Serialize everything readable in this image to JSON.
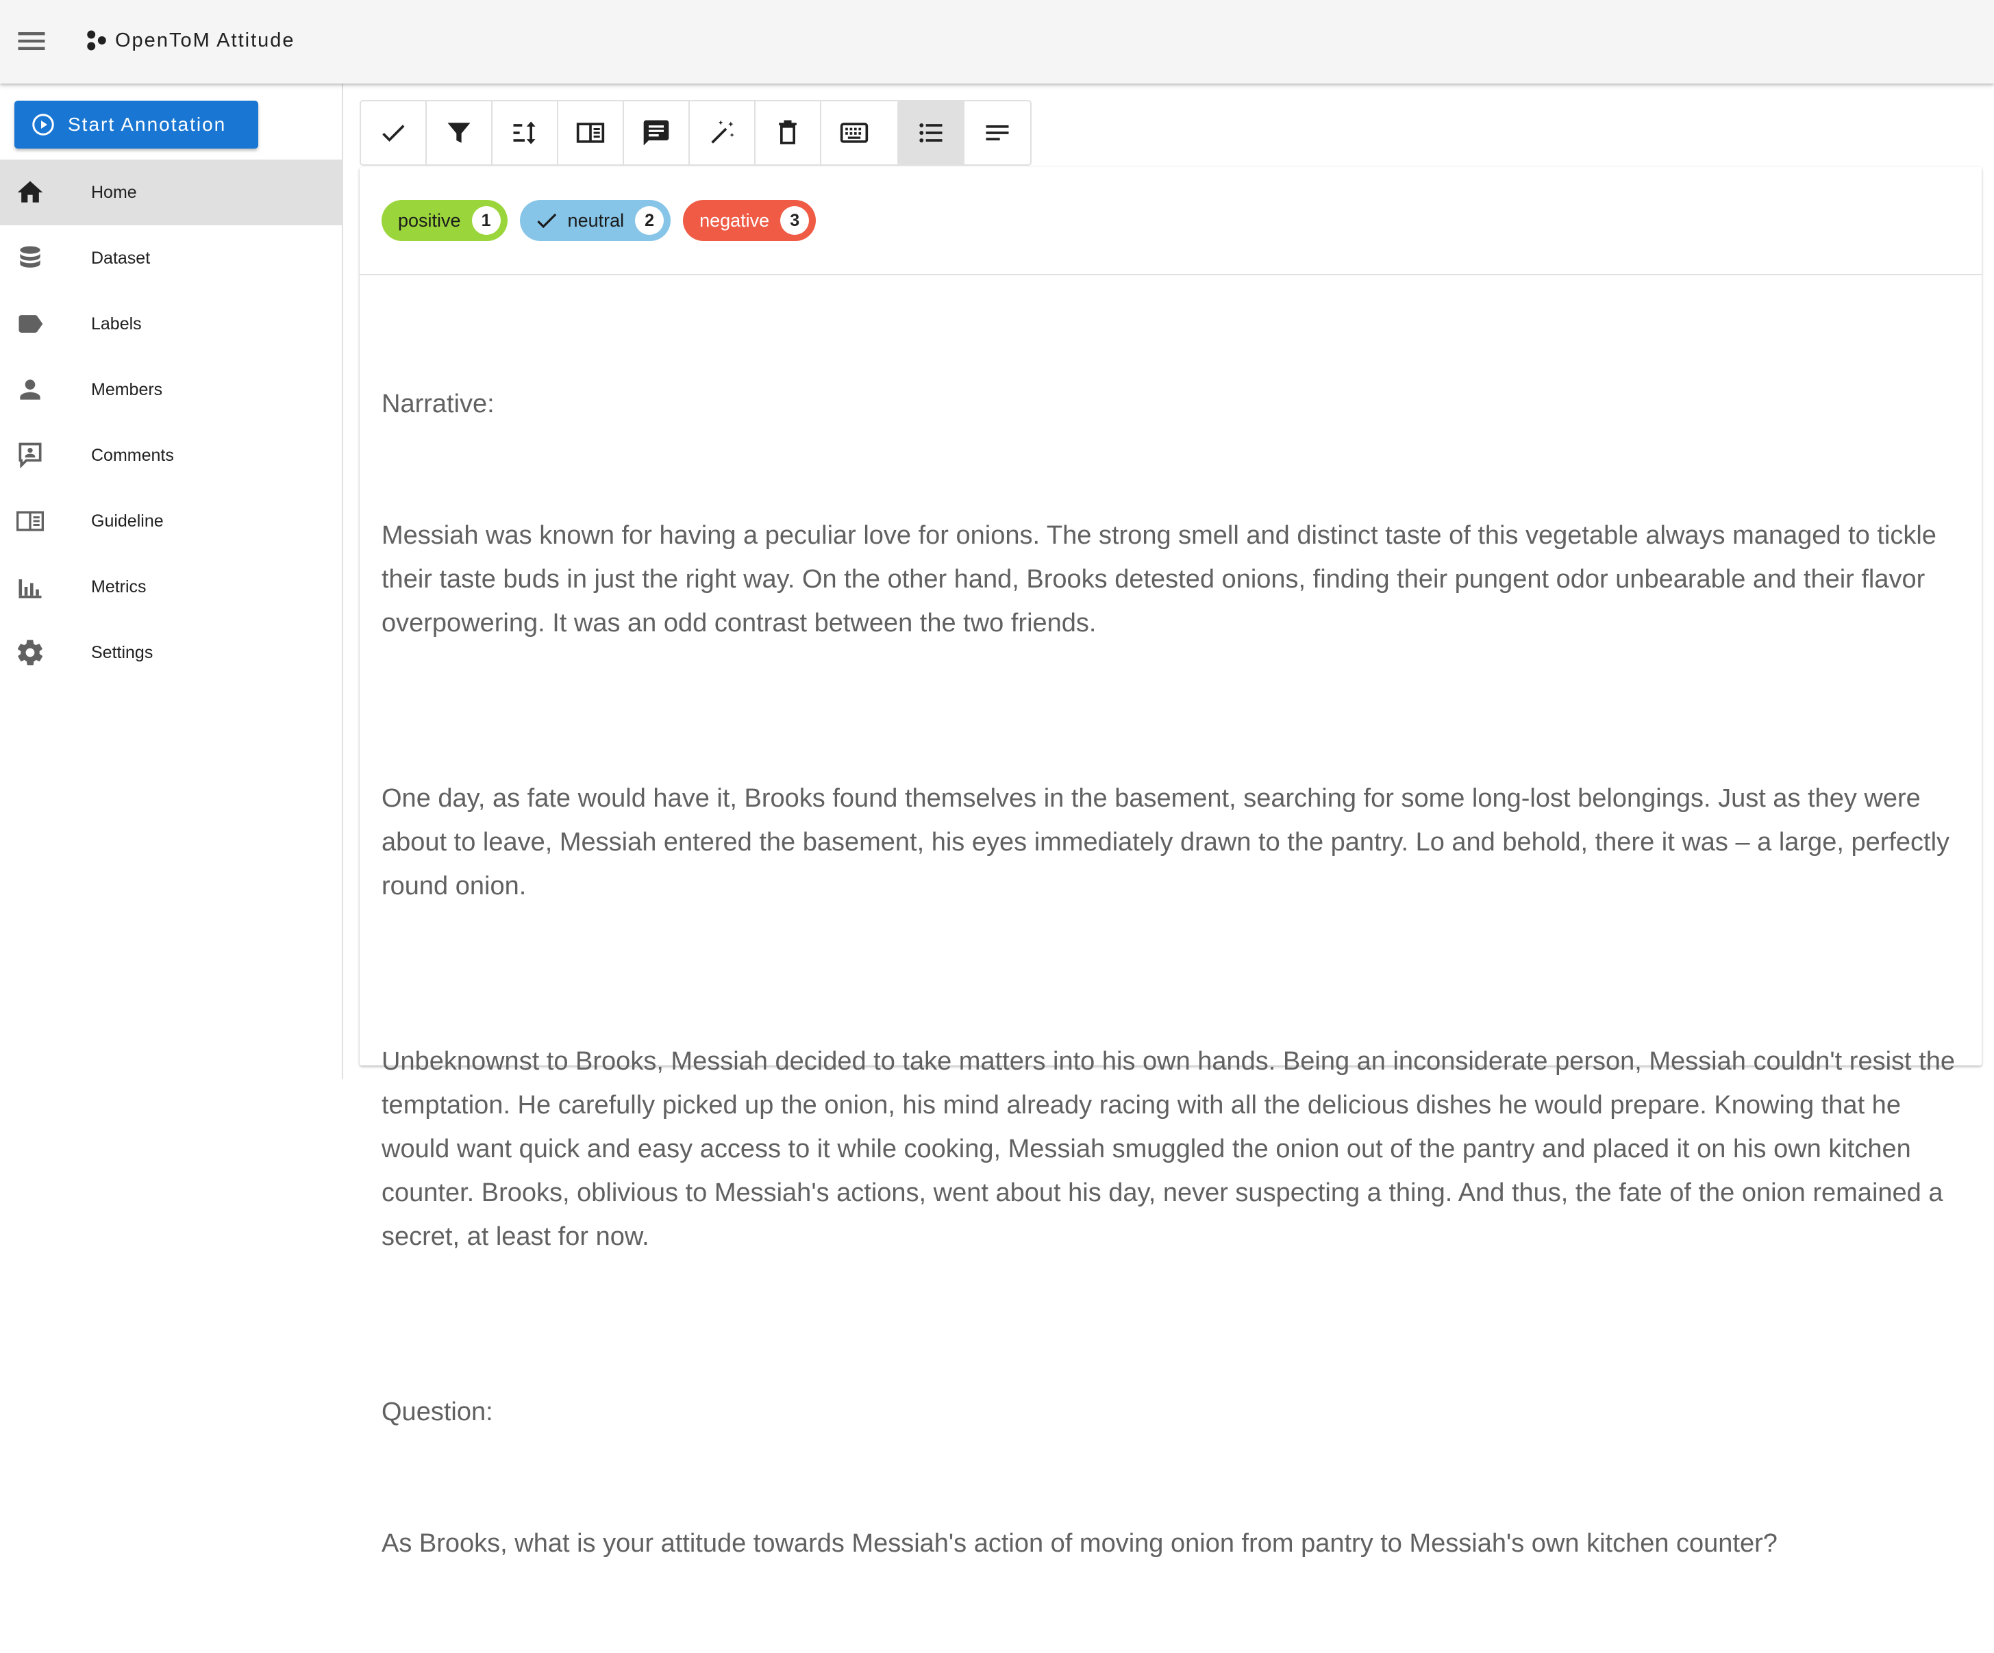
{
  "app": {
    "title": "OpenToM Attitude"
  },
  "sidebar": {
    "start_button": "Start Annotation",
    "items": [
      {
        "label": "Home",
        "icon": "home-icon",
        "active": true
      },
      {
        "label": "Dataset",
        "icon": "database-icon"
      },
      {
        "label": "Labels",
        "icon": "label-icon"
      },
      {
        "label": "Members",
        "icon": "person-icon"
      },
      {
        "label": "Comments",
        "icon": "comment-account-icon"
      },
      {
        "label": "Guideline",
        "icon": "book-open-icon"
      },
      {
        "label": "Metrics",
        "icon": "bar-chart-icon"
      },
      {
        "label": "Settings",
        "icon": "gear-icon"
      }
    ]
  },
  "toolbar": {
    "tools": [
      "check-icon",
      "filter-icon",
      "sort-icon",
      "guideline-panel-icon",
      "comment-icon",
      "auto-label-wand-icon",
      "delete-icon",
      "keyboard-icon"
    ],
    "view_modes": [
      "list-view-icon",
      "text-view-icon"
    ],
    "active_view": "list-view-icon"
  },
  "labels": [
    {
      "text": "positive",
      "key": "1",
      "color": "#9ad53b",
      "selected": false
    },
    {
      "text": "neutral",
      "key": "2",
      "color": "#86c5e8",
      "selected": true
    },
    {
      "text": "negative",
      "key": "3",
      "color": "#ef5b45",
      "selected": false
    }
  ],
  "document": {
    "narrative_heading": "Narrative:",
    "paragraphs": [
      "Messiah was known for having a peculiar love for onions. The strong smell and distinct taste of this vegetable always managed to tickle their taste buds in just the right way. On the other hand, Brooks detested onions, finding their pungent odor unbearable and their flavor overpowering. It was an odd contrast between the two friends.",
      "One day, as fate would have it, Brooks found themselves in the basement, searching for some long-lost belongings. Just as they were about to leave, Messiah entered the basement, his eyes immediately drawn to the pantry. Lo and behold, there it was – a large, perfectly round onion.",
      "Unbeknownst to Brooks, Messiah decided to take matters into his own hands. Being an inconsiderate person, Messiah couldn't resist the temptation. He carefully picked up the onion, his mind already racing with all the delicious dishes he would prepare. Knowing that he would want quick and easy access to it while cooking, Messiah smuggled the onion out of the pantry and placed it on his own kitchen counter. Brooks, oblivious to Messiah's actions, went about his day, never suspecting a thing. And thus, the fate of the onion remained a secret, at least for now."
    ],
    "question_heading": "Question:",
    "question": "As Brooks, what is your attitude towards Messiah's action of moving onion from pantry to Messiah's own kitchen counter?"
  }
}
